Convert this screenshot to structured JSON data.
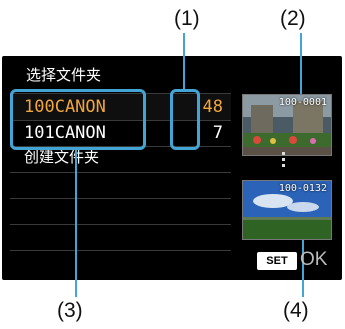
{
  "callouts": [
    "(1)",
    "(2)",
    "(3)",
    "(4)"
  ],
  "screen": {
    "title": "选择文件夹",
    "folders": [
      {
        "name": "100CANON",
        "count": "48",
        "selected": true
      },
      {
        "name": "101CANON",
        "count": "7",
        "selected": false
      }
    ],
    "create_label": "创建文件夹",
    "thumbnails": [
      {
        "label": "100-0001"
      },
      {
        "label": "100-0132"
      }
    ],
    "set_label": "SET",
    "ok_label": "OK"
  },
  "colors": {
    "selected_text": "#f1a63c",
    "frame": "#42a5d6",
    "screen_bg": "#000000"
  }
}
